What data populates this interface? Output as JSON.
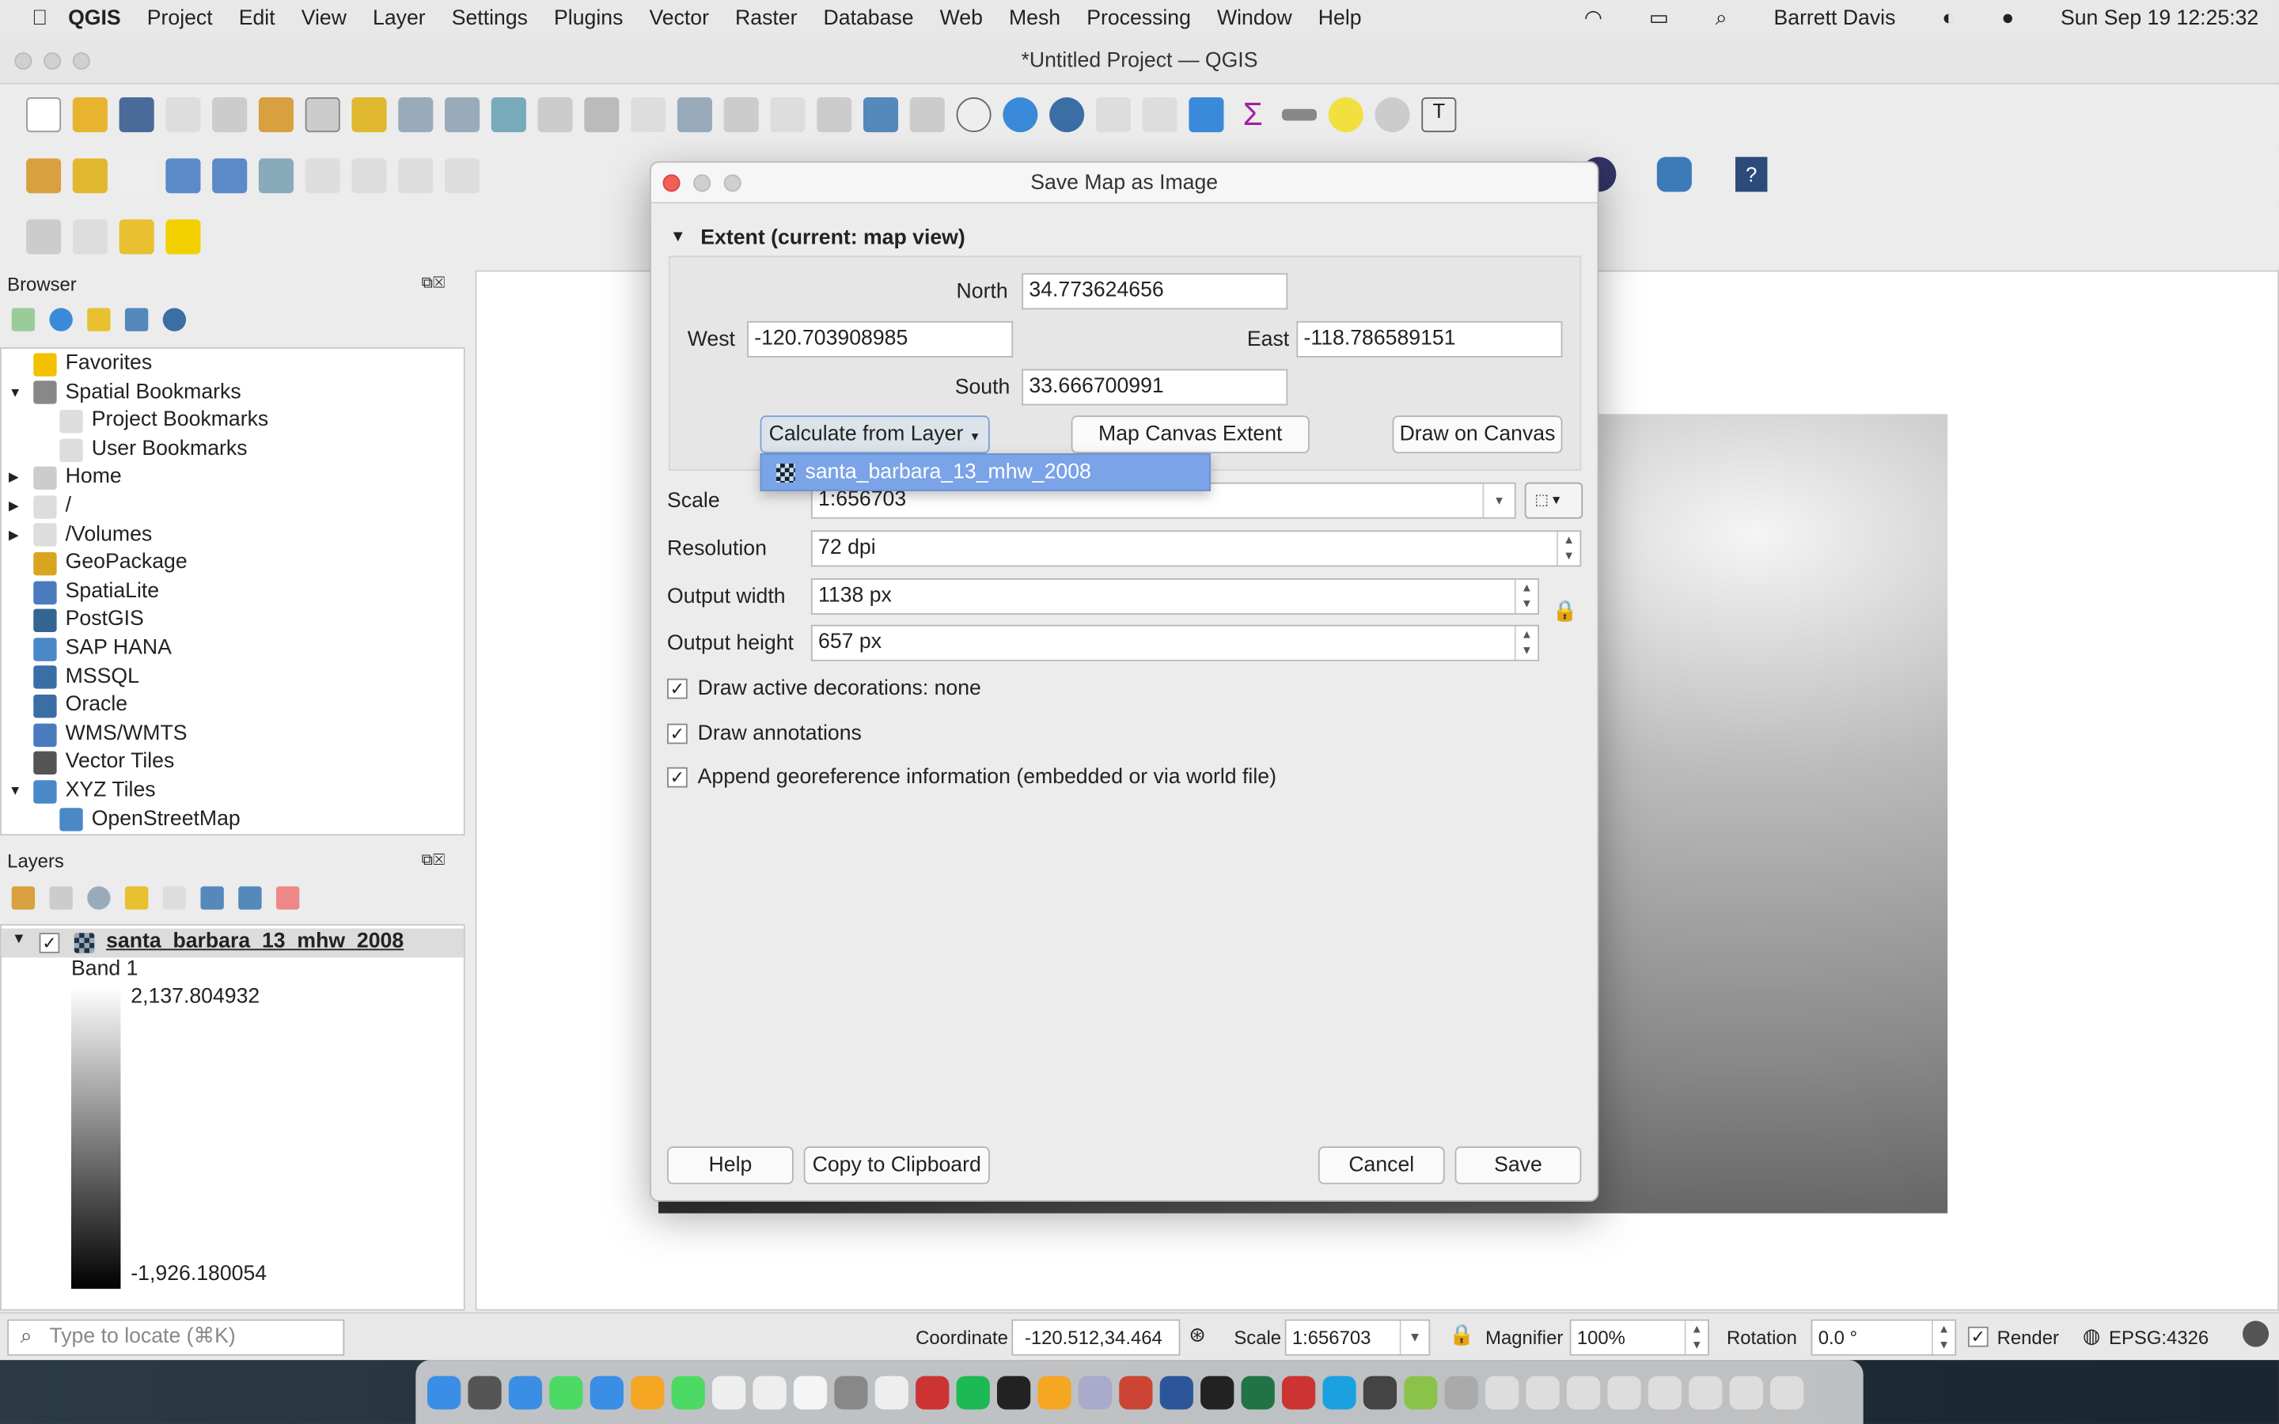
{
  "menubar": {
    "app": "QGIS",
    "items": [
      "Project",
      "Edit",
      "View",
      "Layer",
      "Settings",
      "Plugins",
      "Vector",
      "Raster",
      "Database",
      "Web",
      "Mesh",
      "Processing",
      "Window",
      "Help"
    ],
    "user": "Barrett Davis",
    "datetime": "Sun Sep 19  12:25:32"
  },
  "window": {
    "title": "*Untitled Project — QGIS"
  },
  "browser": {
    "title": "Browser",
    "items": [
      {
        "label": "Favorites",
        "icon": "star-icon",
        "color": "#f2c200"
      },
      {
        "label": "Spatial Bookmarks",
        "icon": "bookmark-icon",
        "color": "#888"
      },
      {
        "label": "Project Bookmarks",
        "icon": "folder-icon",
        "color": "#ddd"
      },
      {
        "label": "User Bookmarks",
        "icon": "folder-icon",
        "color": "#ddd"
      },
      {
        "label": "Home",
        "icon": "home-icon",
        "color": "#ccc"
      },
      {
        "label": "/",
        "icon": "folder-icon",
        "color": "#ddd"
      },
      {
        "label": "/Volumes",
        "icon": "folder-icon",
        "color": "#ddd"
      },
      {
        "label": "GeoPackage",
        "icon": "geopackage-icon",
        "color": "#d9a520"
      },
      {
        "label": "SpatiaLite",
        "icon": "spatialite-icon",
        "color": "#4a7bbf"
      },
      {
        "label": "PostGIS",
        "icon": "postgis-icon",
        "color": "#336791"
      },
      {
        "label": "SAP HANA",
        "icon": "sap-hana-icon",
        "color": "#4a88c8"
      },
      {
        "label": "MSSQL",
        "icon": "mssql-icon",
        "color": "#3a6ea5"
      },
      {
        "label": "Oracle",
        "icon": "oracle-icon",
        "color": "#3a6ea5"
      },
      {
        "label": "WMS/WMTS",
        "icon": "globe-icon",
        "color": "#4a7bbf"
      },
      {
        "label": "Vector Tiles",
        "icon": "grid-icon",
        "color": "#555"
      },
      {
        "label": "XYZ Tiles",
        "icon": "grid-icon",
        "color": "#4a88c8"
      },
      {
        "label": "OpenStreetMap",
        "icon": "grid-icon",
        "color": "#4a88c8"
      }
    ]
  },
  "layers": {
    "title": "Layers",
    "layer_name": "santa_barbara_13_mhw_2008",
    "band": "Band 1",
    "max": "2,137.804932",
    "min": "-1,926.180054"
  },
  "dialog": {
    "title": "Save Map as Image",
    "section": "Extent (current: map view)",
    "north_label": "North",
    "north": "34.773624656",
    "west_label": "West",
    "west": "-120.703908985",
    "east_label": "East",
    "east": "-118.786589151",
    "south_label": "South",
    "south": "33.666700991",
    "calc_btn": "Calculate from Layer",
    "canvas_btn": "Map Canvas Extent",
    "draw_btn": "Draw on Canvas",
    "dropdown_item": "santa_barbara_13_mhw_2008",
    "scale_label": "Scale",
    "scale": "1:656703",
    "res_label": "Resolution",
    "res": "72 dpi",
    "width_label": "Output width",
    "width": "1138 px",
    "height_label": "Output height",
    "height": "657 px",
    "chk1": "Draw active decorations: none",
    "chk2": "Draw annotations",
    "chk3": "Append georeference information (embedded or via world file)",
    "help": "Help",
    "copy": "Copy to Clipboard",
    "cancel": "Cancel",
    "save": "Save"
  },
  "statusbar": {
    "locate_placeholder": "Type to locate (⌘K)",
    "coord_label": "Coordinate",
    "coord": "-120.512,34.464",
    "scale_label": "Scale",
    "scale": "1:656703",
    "mag_label": "Magnifier",
    "mag": "100%",
    "rot_label": "Rotation",
    "rot": "0.0 °",
    "render": "Render",
    "crs": "EPSG:4326"
  }
}
